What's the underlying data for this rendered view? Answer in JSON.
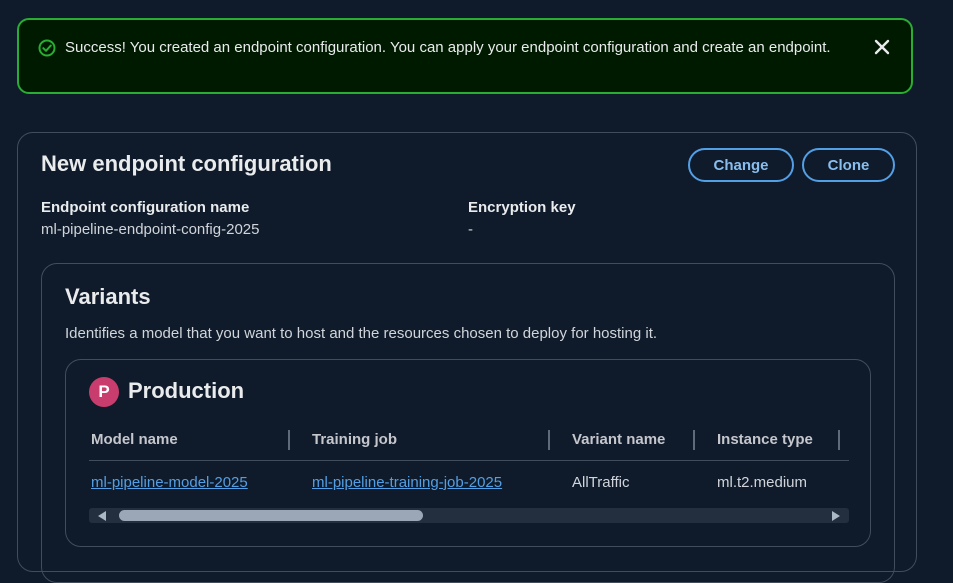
{
  "flash": {
    "message": "Success! You created an endpoint configuration. You can apply your endpoint configuration and create an endpoint."
  },
  "config": {
    "title": "New endpoint configuration",
    "change_label": "Change",
    "clone_label": "Clone",
    "name_label": "Endpoint configuration name",
    "name_value": "ml-pipeline-endpoint-config-2025",
    "encryption_label": "Encryption key",
    "encryption_value": "-"
  },
  "variants": {
    "title": "Variants",
    "description": "Identifies a model that you want to host and the resources chosen to deploy for hosting it.",
    "production": {
      "badge": "P",
      "title": "Production",
      "columns": [
        "Model name",
        "Training job",
        "Variant name",
        "Instance type"
      ],
      "row": {
        "model_name": "ml-pipeline-model-2025",
        "training_job": "ml-pipeline-training-job-2025",
        "variant_name": "AllTraffic",
        "instance_type": "ml.t2.medium"
      }
    }
  },
  "colors": {
    "success": "#29ad32",
    "link": "#539fe5",
    "badge": "#c93d6e",
    "background": "#0f1b2a"
  },
  "icons": [
    "success-check-icon",
    "close-icon",
    "scroll-left-icon",
    "scroll-right-icon"
  ]
}
